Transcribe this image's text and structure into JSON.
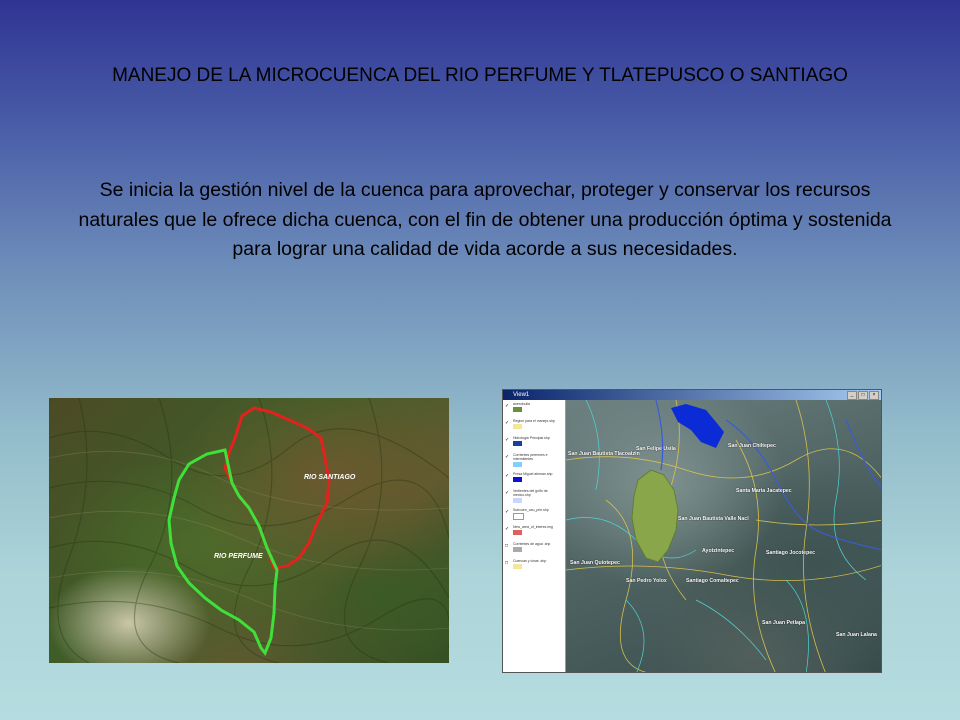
{
  "slide": {
    "title": "MANEJO DE LA MICROCUENCA DEL RIO PERFUME Y TLATEPUSCO O SANTIAGO",
    "body": "Se inicia la gestión  nivel de la cuenca para aprovechar, proteger y conservar los recursos naturales que le ofrece dicha cuenca, con el fin de obtener una producción óptima y sostenida para lograr una calidad de vida acorde a sus necesidades."
  },
  "left_map": {
    "label_santiago": "RIO SANTIAGO",
    "label_perfume": "RIO PERFUME",
    "colors": {
      "santiago_boundary": "#e3221b",
      "perfume_boundary": "#3fe03a"
    }
  },
  "gis_window": {
    "title": "View1",
    "buttons": [
      "_",
      "□",
      "×"
    ],
    "legend": [
      {
        "label": "anexohuila",
        "swatch": "#6a8f3a"
      },
      {
        "label": "Region para el manejo.shp",
        "swatch": "#f4e79a"
      },
      {
        "label": "Hidrologia Principal.shp",
        "swatch": "#1b3fa0"
      },
      {
        "label": "Corrientes perennes e intermitentes",
        "swatch": "#7fd0ff"
      },
      {
        "label": "Presa Miguel aleman.shp",
        "swatch": "#1010d0"
      },
      {
        "label": "Vertientes del golfo de mexico.shp",
        "swatch": "#c9d4ff"
      },
      {
        "label": "Subcuen_cau_prin.shp",
        "swatch": "#ffffff"
      },
      {
        "label": "New_area_of_interes.img",
        "swatch": "#e06060"
      },
      {
        "label": "Corrientes de agua .shp",
        "swatch": "#aaaaaa"
      },
      {
        "label": "Cuencas y cinas .shp",
        "swatch": "#f4e79a"
      }
    ],
    "towns": [
      "San Juan Bautista Tlacoatzin",
      "San Felipe Usila",
      "San Juan Chiltepec",
      "Santa Maria Jacatepec",
      "San Juan Bautista Valle Nacl",
      "San Juan Quiotepec",
      "Ayotzintepec",
      "Santiago Jocotepec",
      "San Pedro Yolox",
      "Santiago Comaltepec",
      "San Juan Petlapa",
      "San Juan Lalana"
    ],
    "colors": {
      "basin_fill": "#8aa64a",
      "dam_fill": "#0b2bd6",
      "boundary": "#e3c94a",
      "river": "#3b5bd6",
      "stream": "#4fd4d4",
      "river_label": "#6cf06c"
    }
  }
}
